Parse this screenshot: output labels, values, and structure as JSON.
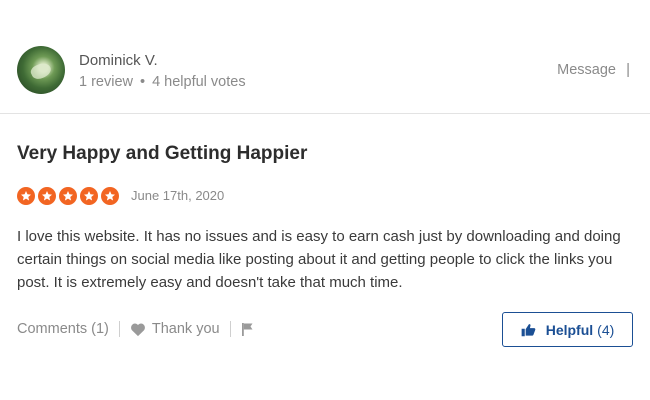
{
  "reviewer": {
    "name": "Dominick V.",
    "review_count": "1 review",
    "separator": "•",
    "helpful_votes": "4 helpful votes",
    "message_label": "Message",
    "message_separator": "|"
  },
  "review": {
    "title": "Very Happy and Getting Happier",
    "rating": 5,
    "rating_max": 5,
    "date": "June 17th, 2020",
    "body": "I love this website. It has no issues and is easy to earn cash just by downloading and doing certain things on social media like posting about it and getting people to click the links you post. It is extremely easy and doesn't take that much time."
  },
  "actions": {
    "comments_label": "Comments (1)",
    "thank_you_label": "Thank you",
    "helpful_label": "Helpful",
    "helpful_count": "(4)"
  },
  "icons": {
    "avatar": "user-photo",
    "stars": "star-icon",
    "thank_you": "heart-icon",
    "flag": "flag-icon",
    "helpful": "thumbs-up-icon"
  },
  "colors": {
    "star": "#f26522",
    "helpful_accent": "#1b4f94",
    "muted_text": "#8a8a8a"
  }
}
